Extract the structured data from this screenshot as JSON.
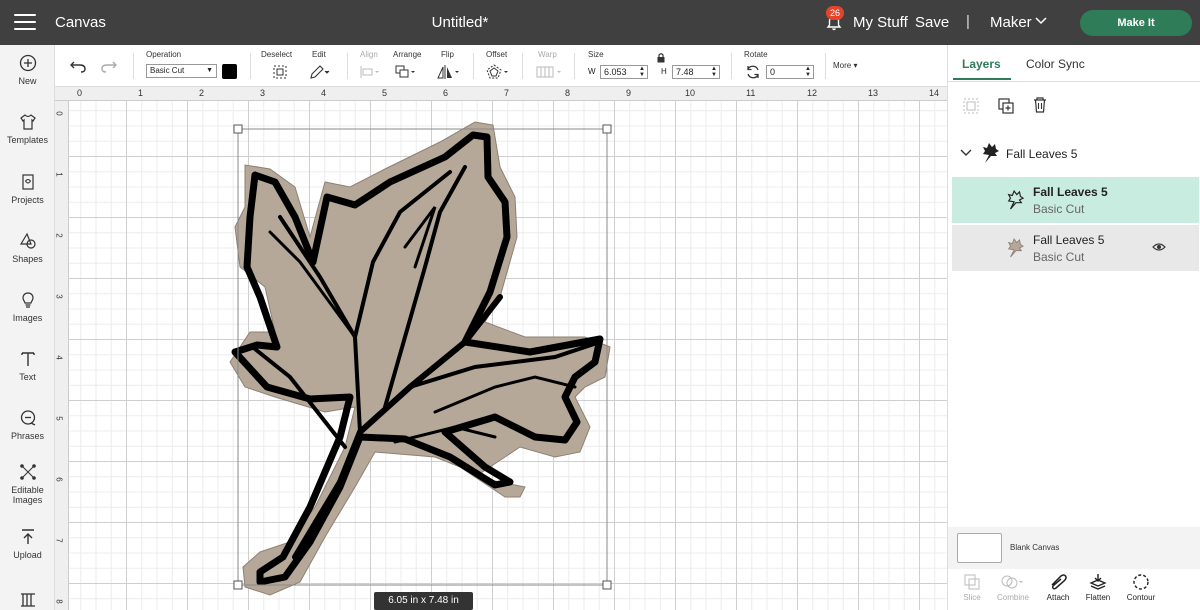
{
  "header": {
    "app_title": "Canvas",
    "doc_title": "Untitled*",
    "notification_count": "26",
    "my_stuff_label": "My Stuff",
    "save_label": "Save",
    "separator": "|",
    "machine_label": "Maker",
    "make_it_label": "Make It",
    "make_it_color": "#2f7d58"
  },
  "leftnav": {
    "items": [
      {
        "label": "New",
        "icon": "plus-circle-icon"
      },
      {
        "label": "Templates",
        "icon": "tshirt-icon"
      },
      {
        "label": "Projects",
        "icon": "projects-icon"
      },
      {
        "label": "Shapes",
        "icon": "shapes-icon"
      },
      {
        "label": "Images",
        "icon": "lightbulb-icon"
      },
      {
        "label": "Text",
        "icon": "text-icon"
      },
      {
        "label": "Phrases",
        "icon": "speech-bubble-icon"
      },
      {
        "label": "Editable",
        "label2": "Images",
        "icon": "editable-images-icon"
      },
      {
        "label": "Upload",
        "icon": "upload-icon"
      }
    ]
  },
  "toolbar": {
    "operation_label": "Operation",
    "operation_value": "Basic Cut",
    "operation_color": "#000000",
    "deselect_label": "Deselect",
    "edit_label": "Edit",
    "align_label": "Align",
    "arrange_label": "Arrange",
    "flip_label": "Flip",
    "offset_label": "Offset",
    "warp_label": "Warp",
    "size_label": "Size",
    "w_label": "W",
    "w_value": "6.053",
    "h_label": "H",
    "h_value": "7.48",
    "rotate_label": "Rotate",
    "rotate_value": "0",
    "more_label": "More"
  },
  "canvas": {
    "ruler_h": [
      "0",
      "1",
      "2",
      "3",
      "4",
      "5",
      "6",
      "7",
      "8",
      "9",
      "10",
      "11",
      "12",
      "13",
      "14"
    ],
    "ruler_v": [
      "0",
      "1",
      "2",
      "3",
      "4",
      "5",
      "6",
      "7",
      "8"
    ],
    "size_readout": "6.05  in x 7.48  in",
    "leaf_fill": "#b5a898",
    "leaf_stroke": "#000000"
  },
  "rightpanel": {
    "tab_layers": "Layers",
    "tab_color_sync": "Color Sync",
    "group_name": "Fall Leaves 5",
    "layers": [
      {
        "name": "Fall Leaves 5",
        "operation": "Basic Cut"
      },
      {
        "name": "Fall Leaves 5",
        "operation": "Basic Cut"
      }
    ],
    "blank_canvas_label": "Blank Canvas",
    "tools": [
      "Slice",
      "Combine",
      "Attach",
      "Flatten",
      "Contour"
    ]
  }
}
